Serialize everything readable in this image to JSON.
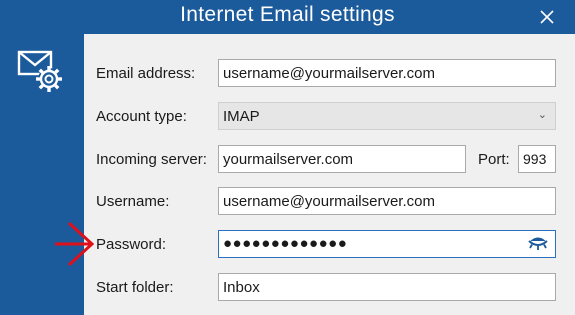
{
  "window": {
    "title": "Internet Email settings"
  },
  "icons": {
    "close": "close-icon",
    "settings": "email-settings-icon",
    "eye": "show-password-icon",
    "arrow": "red-arrow-annotation"
  },
  "colors": {
    "titlebar": "#1b5a9b",
    "panel": "#f0f0f0",
    "arrow": "#e0101a",
    "eye": "#1b5a9b"
  },
  "form": {
    "email": {
      "label": "Email address:",
      "value": "username@yourmailserver.com"
    },
    "account_type": {
      "label": "Account type:",
      "value": "IMAP"
    },
    "incoming_server": {
      "label": "Incoming server:",
      "value": "yourmailserver.com",
      "port_label": "Port:",
      "port_value": "993"
    },
    "username": {
      "label": "Username:",
      "value": "username@yourmailserver.com"
    },
    "password": {
      "label": "Password:",
      "value": "●●●●●●●●●●●●●"
    },
    "start_folder": {
      "label": "Start folder:",
      "value": "Inbox"
    }
  }
}
